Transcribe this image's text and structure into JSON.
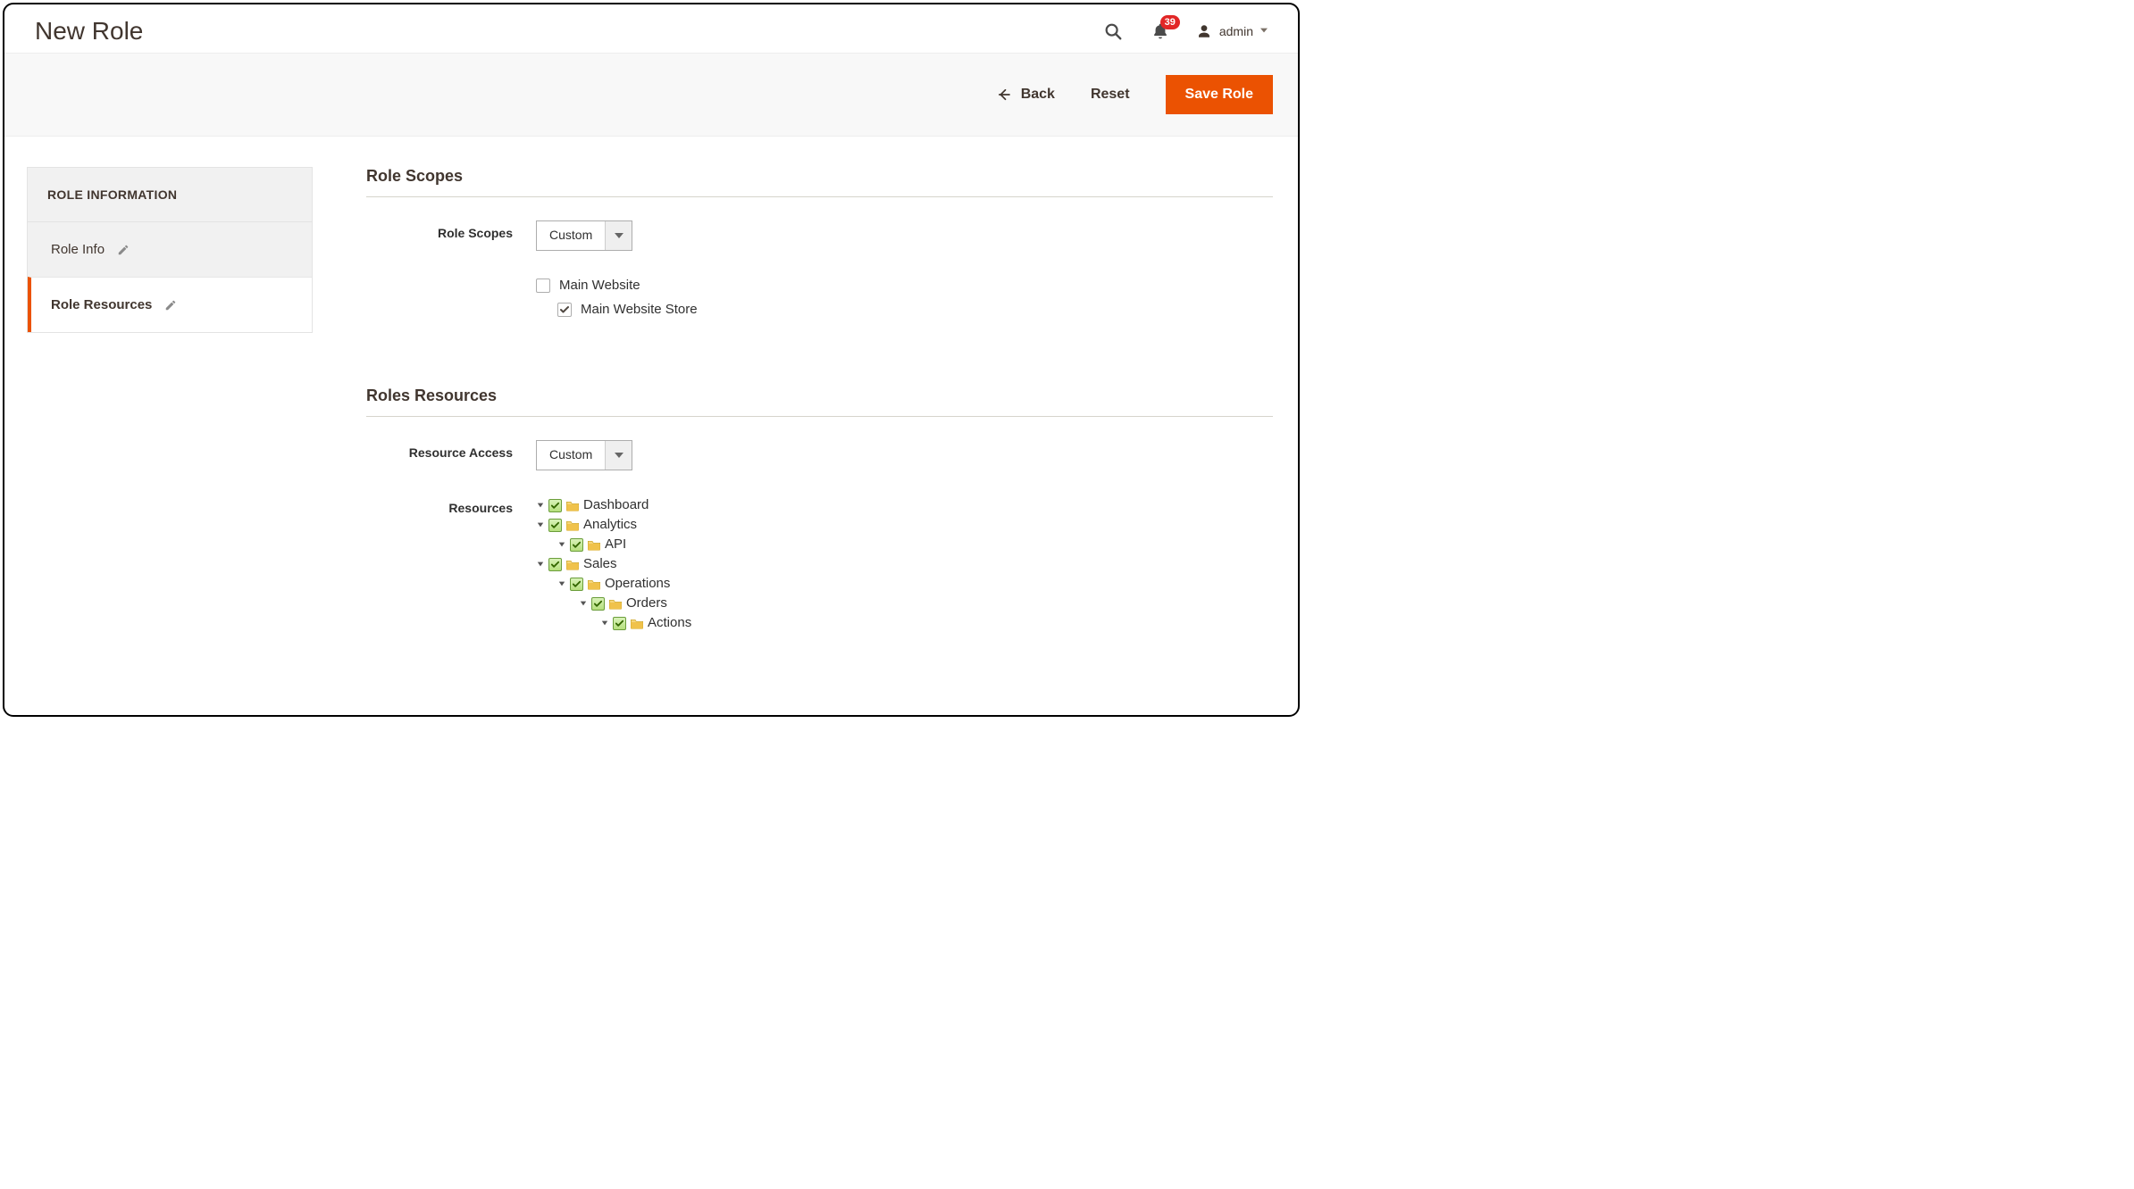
{
  "header": {
    "title": "New Role",
    "notification_count": "39",
    "admin_user": "admin"
  },
  "actions": {
    "back": "Back",
    "reset": "Reset",
    "save": "Save Role"
  },
  "sidebar": {
    "heading": "ROLE INFORMATION",
    "tabs": [
      {
        "label": "Role Info"
      },
      {
        "label": "Role Resources"
      }
    ]
  },
  "scopes": {
    "section_title": "Role Scopes",
    "label": "Role Scopes",
    "value": "Custom",
    "websites": {
      "main": "Main Website",
      "store": "Main Website Store"
    }
  },
  "resources": {
    "section_title": "Roles Resources",
    "access_label": "Resource Access",
    "access_value": "Custom",
    "tree_label": "Resources",
    "tree": {
      "dashboard": "Dashboard",
      "analytics": "Analytics",
      "api": "API",
      "sales": "Sales",
      "operations": "Operations",
      "orders": "Orders",
      "actions": "Actions"
    }
  }
}
